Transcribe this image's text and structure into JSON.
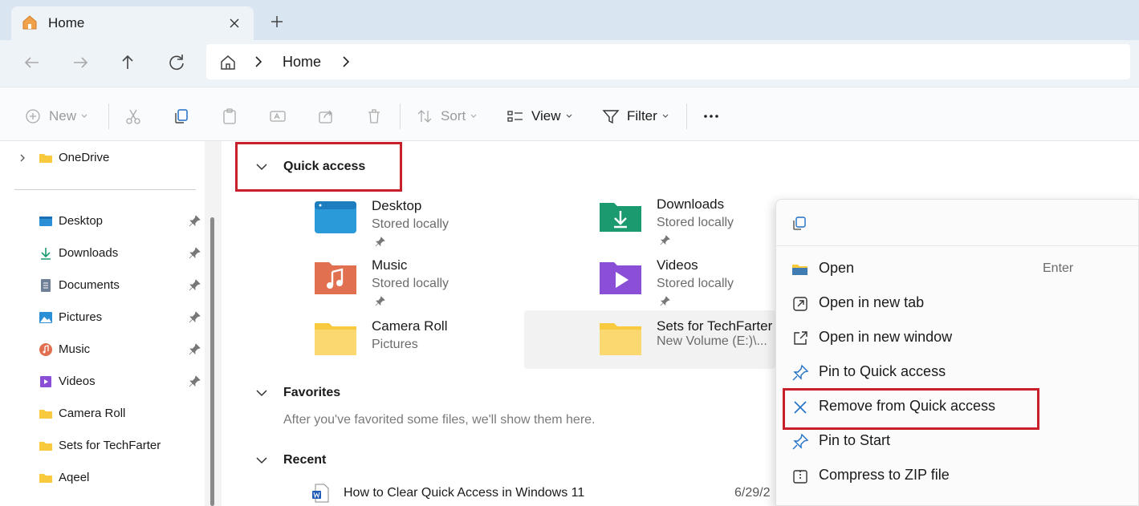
{
  "tab": {
    "title": "Home"
  },
  "address": {
    "location": "Home"
  },
  "toolbar": {
    "new_label": "New",
    "sort_label": "Sort",
    "view_label": "View",
    "filter_label": "Filter"
  },
  "sidebar": {
    "onedrive": "OneDrive",
    "items": [
      {
        "label": "Desktop",
        "pinned": true
      },
      {
        "label": "Downloads",
        "pinned": true
      },
      {
        "label": "Documents",
        "pinned": true
      },
      {
        "label": "Pictures",
        "pinned": true
      },
      {
        "label": "Music",
        "pinned": true
      },
      {
        "label": "Videos",
        "pinned": true
      },
      {
        "label": "Camera Roll",
        "pinned": false
      },
      {
        "label": "Sets for TechFarter",
        "pinned": false
      },
      {
        "label": "Aqeel",
        "pinned": false
      }
    ]
  },
  "quick_access": {
    "heading": "Quick access",
    "tiles": [
      {
        "name": "Desktop",
        "sub": "Stored locally",
        "pinned": true
      },
      {
        "name": "Downloads",
        "sub": "Stored locally",
        "pinned": true
      },
      {
        "name": "Music",
        "sub": "Stored locally",
        "pinned": true
      },
      {
        "name": "Videos",
        "sub": "Stored locally",
        "pinned": true
      },
      {
        "name": "Camera Roll",
        "sub": "Pictures",
        "pinned": false
      },
      {
        "name": "Sets for TechFarter",
        "sub": "New Volume (E:)\\...",
        "pinned": false
      }
    ]
  },
  "favorites": {
    "heading": "Favorites",
    "empty_note": "After you've favorited some files, we'll show them here."
  },
  "recent": {
    "heading": "Recent",
    "rows": [
      {
        "name": "How to Clear Quick Access in Windows 11",
        "date": "6/29/2"
      }
    ]
  },
  "context_menu": {
    "items": [
      {
        "label": "Open",
        "accelerator": "Enter"
      },
      {
        "label": "Open in new tab"
      },
      {
        "label": "Open in new window"
      },
      {
        "label": "Pin to Quick access"
      },
      {
        "label": "Remove from Quick access"
      },
      {
        "label": "Pin to Start"
      },
      {
        "label": "Compress to ZIP file"
      }
    ]
  },
  "colors": {
    "highlight": "#c8202a",
    "folder_yellow": "#f9c93e",
    "accent_blue": "#1f6fc5"
  }
}
